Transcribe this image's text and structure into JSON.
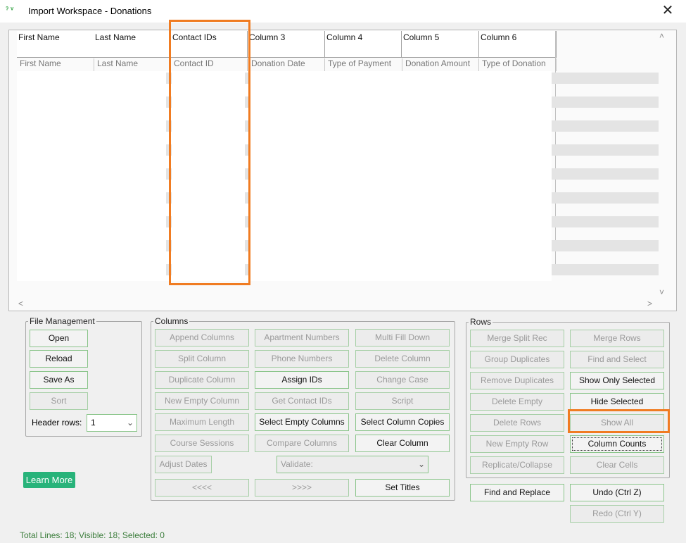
{
  "window": {
    "title": "Import Workspace - Donations",
    "close_glyph": "✕",
    "logo_glyph": "ˀ ᵛ"
  },
  "grid": {
    "headers": [
      "First Name",
      "Last Name",
      "Contact IDs",
      "Column 3",
      "Column 4",
      "Column 5",
      "Column 6"
    ],
    "title_row": [
      "First Name",
      "Last Name",
      "Contact ID",
      "Donation Date",
      "Type of Payment",
      "Donation Amount",
      "Type of Donation"
    ]
  },
  "file_management": {
    "legend": "File Management",
    "open": "Open",
    "reload": "Reload",
    "save_as": "Save As",
    "sort": "Sort",
    "header_rows_label": "Header rows:",
    "header_rows_value": "1"
  },
  "columns": {
    "legend": "Columns",
    "append_columns": "Append Columns",
    "apartment_numbers": "Apartment Numbers",
    "multi_fill_down": "Multi Fill Down",
    "split_column": "Split Column",
    "phone_numbers": "Phone Numbers",
    "delete_column": "Delete Column",
    "duplicate_column": "Duplicate Column",
    "assign_ids": "Assign IDs",
    "change_case": "Change Case",
    "new_empty_column": "New Empty Column",
    "get_contact_ids": "Get Contact IDs",
    "script": "Script",
    "maximum_length": "Maximum Length",
    "select_empty_columns": "Select Empty Columns",
    "select_column_copies": "Select Column Copies",
    "course_sessions": "Course Sessions",
    "compare_columns": "Compare Columns",
    "clear_column": "Clear Column",
    "adjust_dates": "Adjust Dates",
    "validate_placeholder": "Validate:",
    "prev": "<<<<",
    "next": ">>>>",
    "set_titles": "Set Titles"
  },
  "rows": {
    "legend": "Rows",
    "merge_split_rec": "Merge Split Rec",
    "merge_rows": "Merge Rows",
    "group_duplicates": "Group Duplicates",
    "find_and_select": "Find and Select",
    "remove_duplicates": "Remove Duplicates",
    "show_only_selected": "Show Only Selected",
    "delete_empty": "Delete Empty",
    "hide_selected": "Hide Selected",
    "delete_rows": "Delete Rows",
    "show_all": "Show All",
    "new_empty_row": "New Empty Row",
    "column_counts": "Column Counts",
    "replicate_collapse": "Replicate/Collapse",
    "clear_cells": "Clear Cells"
  },
  "bottom": {
    "find_and_replace": "Find and Replace",
    "undo": "Undo (Ctrl Z)",
    "redo": "Redo (Ctrl Y)",
    "learn_more": "Learn More",
    "status": "Total Lines: 18; Visible: 18; Selected: 0"
  },
  "colors": {
    "accent_green": "#28b37a",
    "highlight_orange": "#f07c22",
    "button_border": "#8bc58b"
  }
}
